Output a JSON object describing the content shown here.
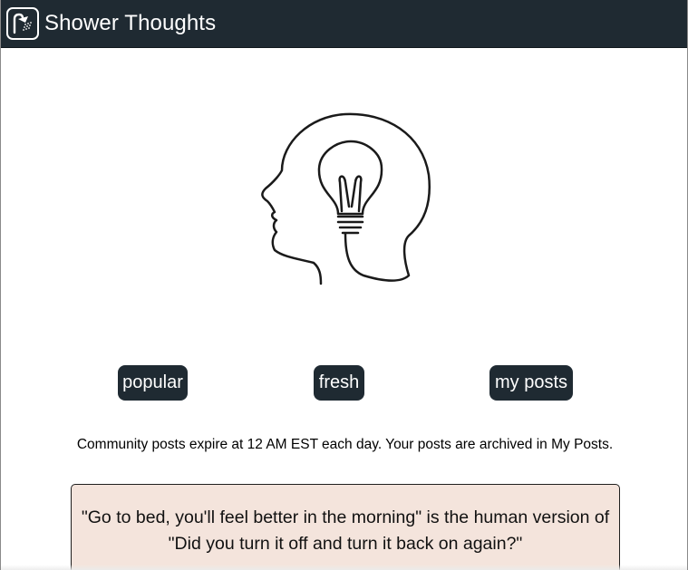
{
  "header": {
    "title": "Shower Thoughts",
    "logo_icon": "shower-head-icon",
    "background": "#1f2a32"
  },
  "hero": {
    "icon": "head-lightbulb-icon"
  },
  "nav": {
    "popular_label": "popular",
    "fresh_label": "fresh",
    "my_posts_label": "my posts"
  },
  "notice": "Community posts expire at 12 AM EST each day. Your posts are archived in My Posts.",
  "posts": [
    {
      "text": "\"Go to bed, you'll feel better in the morning\" is the human version of \"Did you turn it off and turn it back on again?\"",
      "background": "#f4e4dc"
    }
  ]
}
